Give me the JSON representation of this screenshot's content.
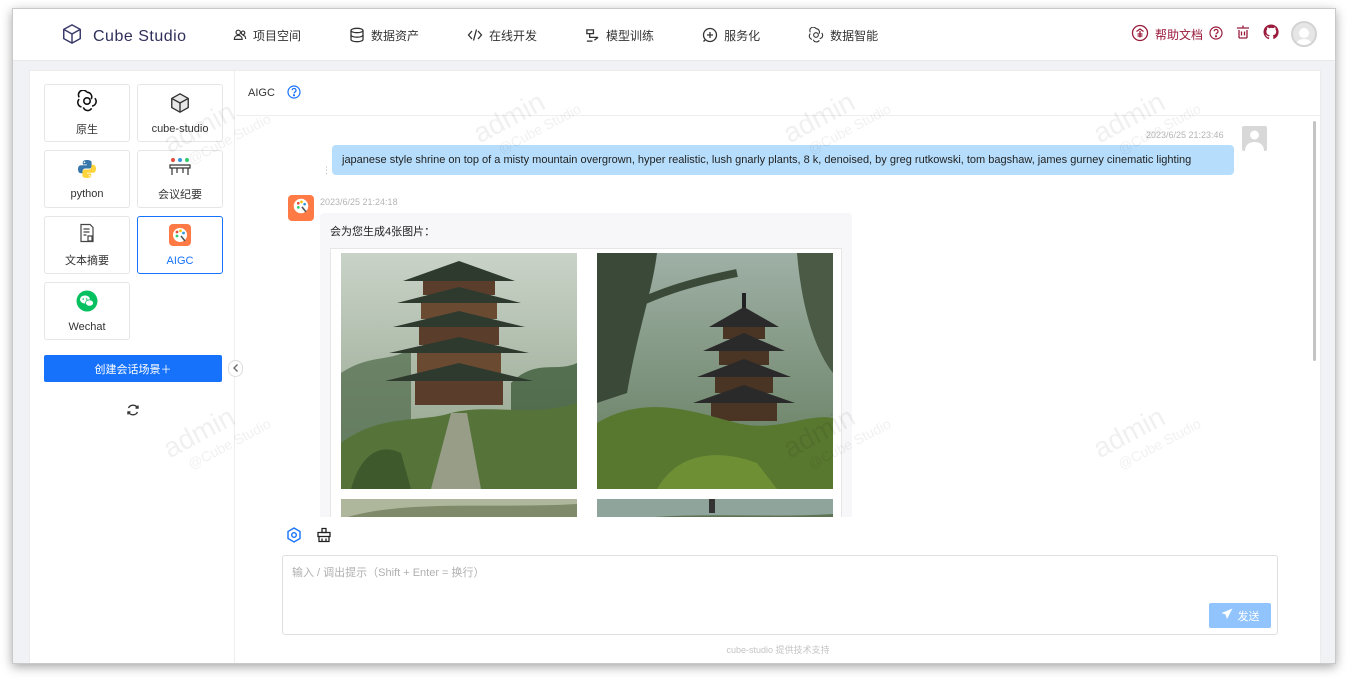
{
  "brand": {
    "name": "Cube Studio"
  },
  "nav": {
    "items": [
      {
        "label": "项目空间",
        "icon": "team-icon"
      },
      {
        "label": "数据资产",
        "icon": "database-icon"
      },
      {
        "label": "在线开发",
        "icon": "code-icon"
      },
      {
        "label": "模型训练",
        "icon": "train-icon"
      },
      {
        "label": "服务化",
        "icon": "service-icon"
      },
      {
        "label": "数据智能",
        "icon": "openai-icon"
      }
    ],
    "help_label": "帮助文档",
    "accent": "#9a1b3c"
  },
  "sidebar": {
    "scenes": [
      {
        "label": "原生",
        "icon": "openai-icon"
      },
      {
        "label": "cube-studio",
        "icon": "cube-icon"
      },
      {
        "label": "python",
        "icon": "python-icon"
      },
      {
        "label": "会议纪要",
        "icon": "meeting-icon"
      },
      {
        "label": "文本摘要",
        "icon": "document-icon"
      },
      {
        "label": "AIGC",
        "icon": "palette-icon",
        "active": true
      },
      {
        "label": "Wechat",
        "icon": "wechat-icon"
      }
    ],
    "create_button": "创建会话场景＋"
  },
  "chat": {
    "title": "AIGC",
    "messages": [
      {
        "role": "user",
        "time": "2023/6/25 21:23:46",
        "text": "japanese style shrine on top of a misty mountain overgrown, hyper realistic, lush gnarly plants, 8 k, denoised, by greg rutkowski, tom bagshaw, james gurney cinematic lighting"
      },
      {
        "role": "assistant",
        "time": "2023/6/25 21:24:18",
        "text": "会为您生成4张图片："
      }
    ]
  },
  "composer": {
    "placeholder": "输入 / 调出提示（Shift + Enter = 换行）",
    "value": "",
    "send_label": "发送"
  },
  "footer": {
    "text": "cube-studio 提供技术支持"
  },
  "watermark": {
    "name": "admin",
    "org": "@Cube Studio"
  },
  "colors": {
    "primary": "#1672fa",
    "user_bubble": "#b6defc",
    "send_disabled": "#91c3fd"
  }
}
